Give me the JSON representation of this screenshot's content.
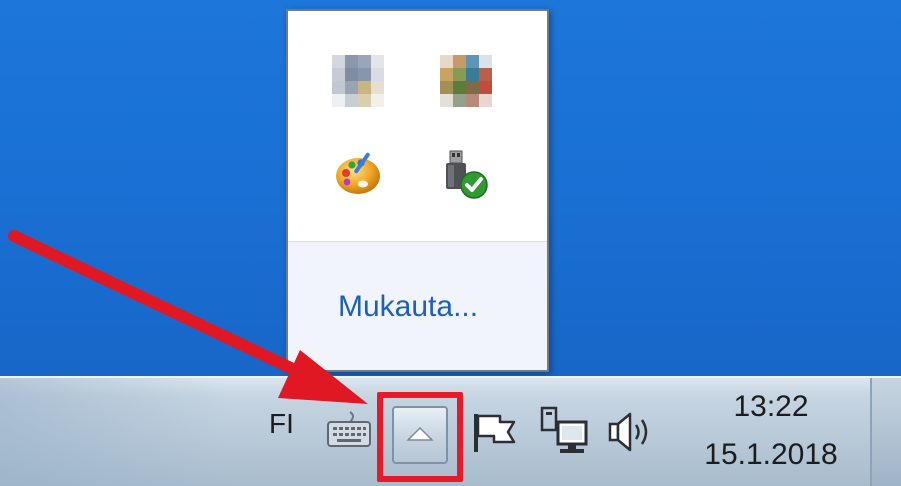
{
  "popup": {
    "customize_label": "Mukauta...",
    "icons": [
      {
        "name": "pixelated-app-icon-1",
        "colors": [
          "#d4d8de",
          "#8b97aa",
          "#9aa5b8",
          "#e3e5ea",
          "#c6cbd4",
          "#7f8ca2",
          "#8796ad",
          "#d9dce2",
          "#c2c8d2",
          "#9aa3b4",
          "#c9b582",
          "#e6dfcf",
          "#eef0f3",
          "#c8cdd6",
          "#d9cfb0",
          "#f2f0ea"
        ]
      },
      {
        "name": "pixelated-app-icon-2",
        "colors": [
          "#e7d9c8",
          "#c79a68",
          "#5b97b4",
          "#d8e3ea",
          "#c6a461",
          "#869c55",
          "#3a7b96",
          "#b95f4b",
          "#a49055",
          "#5c7c3c",
          "#7f6b45",
          "#c14b3c",
          "#e3e0d6",
          "#93a38a",
          "#b88a7a",
          "#e8d6d0"
        ]
      }
    ]
  },
  "taskbar": {
    "language": "FI",
    "clock_time": "13:22",
    "clock_date": "15.1.2018"
  },
  "colors": {
    "desktop_blue": "#1a6fd3",
    "highlight_red": "#e51b2a",
    "link_blue": "#1d5fbf"
  },
  "icons": {
    "keyboard": "keyboard-icon",
    "overflow": "chevron-up-icon",
    "action_center": "flag-icon",
    "network": "network-icon",
    "volume": "speaker-icon",
    "paint": "paint-palette-icon",
    "usb": "usb-safely-remove-icon"
  }
}
